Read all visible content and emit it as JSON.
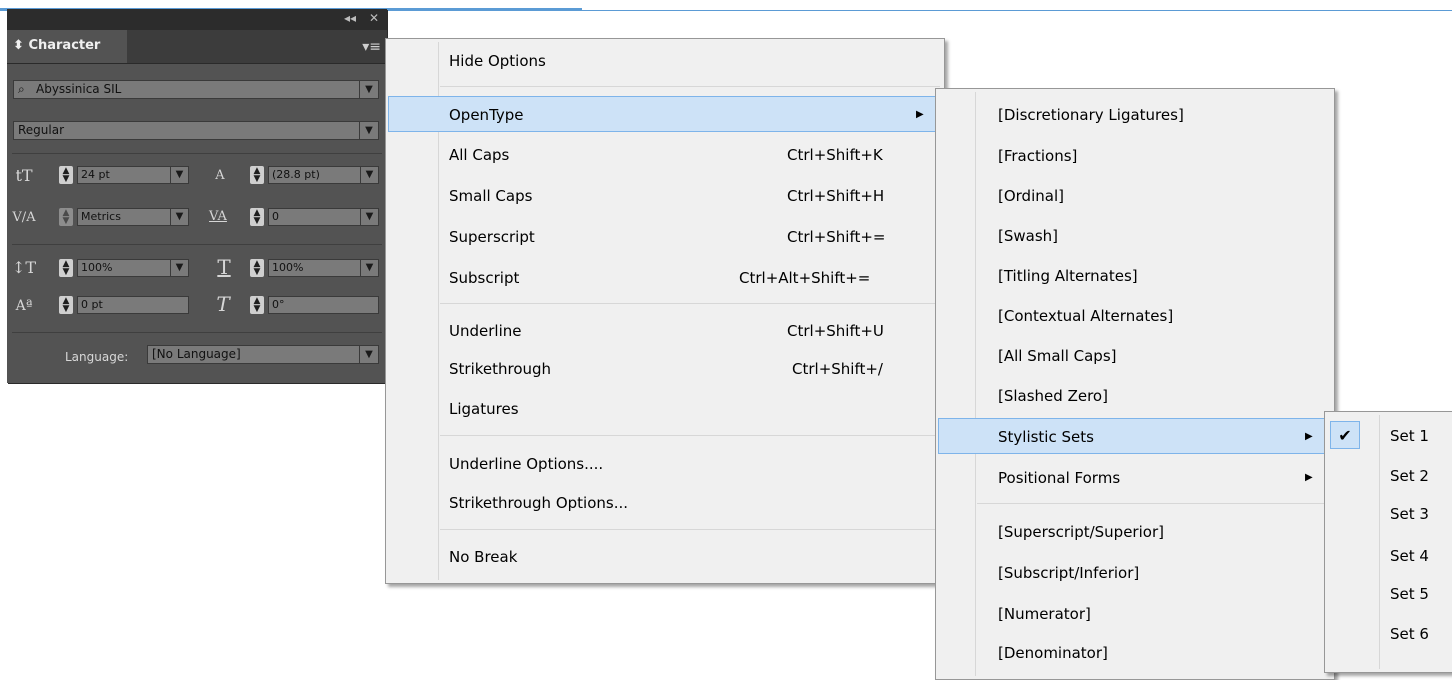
{
  "panel": {
    "title_buttons": {
      "collapse": "◂◂",
      "close": "✕"
    },
    "tab_label": "Character",
    "tab_icon": "⬍",
    "menu_icon": "▾≡",
    "font_family": "Abyssinica SIL",
    "font_style": "Regular",
    "font_size": "24 pt",
    "leading": "(28.8 pt)",
    "kerning": "Metrics",
    "tracking": "0",
    "vertical_scale": "100%",
    "horizontal_scale": "100%",
    "baseline_shift": "0 pt",
    "skew": "0°",
    "language_label": "Language:",
    "language_value": "[No Language]",
    "dropdown_arrow": "▼",
    "icons": {
      "font_size": "tT",
      "leading": "A",
      "kerning": "V/A",
      "tracking": "VA",
      "vertical_scale": "↕T",
      "horizontal_scale": "T",
      "baseline_shift": "Aª",
      "skew": "T"
    }
  },
  "menu_main": {
    "items": [
      {
        "label": "Hide Options",
        "shortcut": ""
      },
      {
        "label": "OpenType",
        "shortcut": "",
        "submenu": true
      },
      {
        "label": "All Caps",
        "shortcut": "Ctrl+Shift+K"
      },
      {
        "label": "Small Caps",
        "shortcut": "Ctrl+Shift+H"
      },
      {
        "label": "Superscript",
        "shortcut": "Ctrl+Shift+="
      },
      {
        "label": "Subscript",
        "shortcut": "Ctrl+Alt+Shift+="
      },
      {
        "label": "Underline",
        "shortcut": "Ctrl+Shift+U"
      },
      {
        "label": "Strikethrough",
        "shortcut": "Ctrl+Shift+/"
      },
      {
        "label": "Ligatures",
        "shortcut": ""
      },
      {
        "label": "Underline Options....",
        "shortcut": ""
      },
      {
        "label": "Strikethrough Options...",
        "shortcut": ""
      },
      {
        "label": "No Break",
        "shortcut": ""
      }
    ],
    "submenu_arrow": "▶"
  },
  "menu_opentype": {
    "items": [
      {
        "label": "[Discretionary Ligatures]"
      },
      {
        "label": "[Fractions]"
      },
      {
        "label": "[Ordinal]"
      },
      {
        "label": "[Swash]"
      },
      {
        "label": "[Titling Alternates]"
      },
      {
        "label": "[Contextual Alternates]"
      },
      {
        "label": "[All Small Caps]"
      },
      {
        "label": "[Slashed Zero]"
      },
      {
        "label": "Stylistic Sets",
        "submenu": true
      },
      {
        "label": "Positional Forms",
        "submenu": true
      },
      {
        "label": "[Superscript/Superior]"
      },
      {
        "label": "[Subscript/Inferior]"
      },
      {
        "label": "[Numerator]"
      },
      {
        "label": "[Denominator]"
      }
    ]
  },
  "menu_stylistic": {
    "check_mark": "✔",
    "items": [
      {
        "label": "Set 1",
        "checked": true
      },
      {
        "label": "Set 2"
      },
      {
        "label": "Set 3"
      },
      {
        "label": "Set 4"
      },
      {
        "label": "Set 5"
      },
      {
        "label": "Set 6"
      }
    ]
  },
  "colors": {
    "panel_bg": "#535353",
    "menu_bg": "#f0f0f0",
    "highlight_bg": "#cde2f7",
    "highlight_border": "#7eb4ea",
    "accent_line": "#5b9bd5"
  }
}
